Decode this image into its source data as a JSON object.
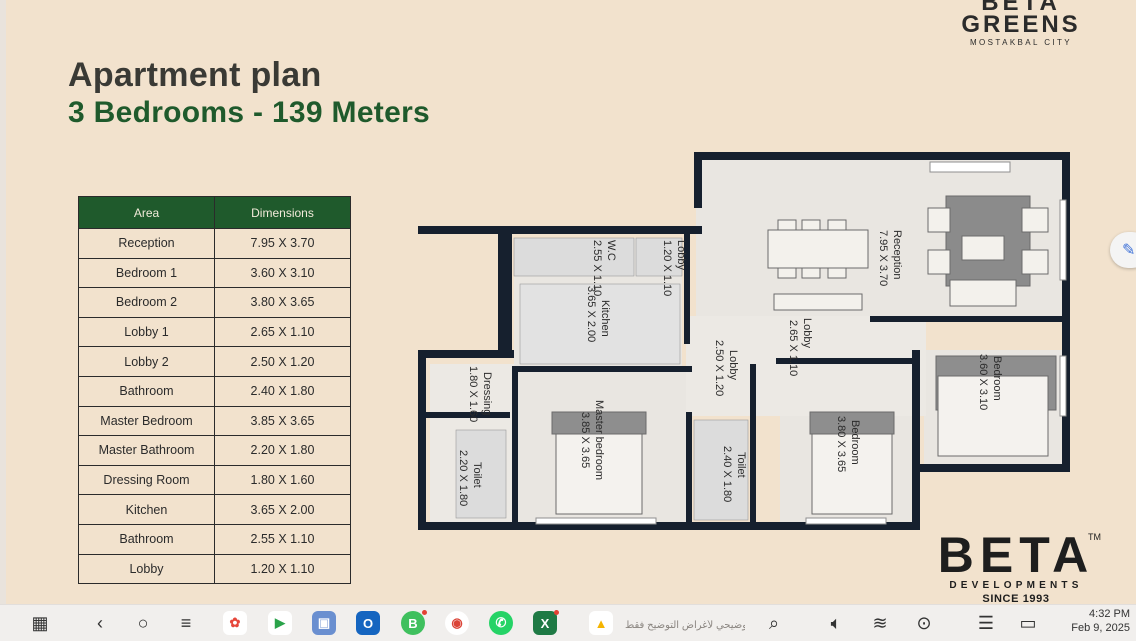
{
  "title": "Apartment plan",
  "subtitle": "3 Bedrooms - 139 Meters",
  "brand_top": {
    "line1": "BETA",
    "line2": "GREENS",
    "line3": "MOSTAKBAL CITY"
  },
  "brand_bottom": {
    "name": "BETA",
    "tm": "TM",
    "tagline": "DEVELOPMENTS",
    "since": "SINCE 1993"
  },
  "table": {
    "headers": [
      "Area",
      "Dimensions"
    ],
    "rows": [
      [
        "Reception",
        "7.95 X 3.70"
      ],
      [
        "Bedroom 1",
        "3.60 X 3.10"
      ],
      [
        "Bedroom 2",
        "3.80 X 3.65"
      ],
      [
        "Lobby 1",
        "2.65 X 1.10"
      ],
      [
        "Lobby 2",
        "2.50 X 1.20"
      ],
      [
        "Bathroom",
        "2.40 X 1.80"
      ],
      [
        "Master Bedroom",
        "3.85 X 3.65"
      ],
      [
        "Master Bathroom",
        "2.20 X 1.80"
      ],
      [
        "Dressing Room",
        "1.80 X 1.60"
      ],
      [
        "Kitchen",
        "3.65 X 2.00"
      ],
      [
        "Bathroom",
        "2.55 X 1.10"
      ],
      [
        "Lobby",
        "1.20 X 1.10"
      ]
    ]
  },
  "plan_labels": {
    "reception": [
      "Reception",
      "7.95 X 3.70"
    ],
    "wc": [
      "W.C",
      "2.55 X 1.10"
    ],
    "lobby_small": [
      "Lobby",
      "1.20 X 1.10"
    ],
    "kitchen": [
      "Kitchen",
      "3.65 X 2.00"
    ],
    "lobby1": [
      "Lobby",
      "2.65 X 1.10"
    ],
    "lobby2": [
      "Lobby",
      "2.50 X 1.20"
    ],
    "dressing": [
      "Dressing",
      "1.80 X 1.60"
    ],
    "toilet1": [
      "Toilet",
      "2.20 X 1.80"
    ],
    "master": [
      "Master bedroom",
      "3.85 X 3.65"
    ],
    "toilet2": [
      "Toilet",
      "2.40 X 1.80"
    ],
    "bedroom2": [
      "Bedroom",
      "3.80 X 3.65"
    ],
    "bedroom1": [
      "Bedroom",
      "3.60 X 3.10"
    ]
  },
  "taskbar": {
    "icons": [
      "apps-grid-icon",
      "back-icon",
      "home-icon",
      "menu-icon",
      "photos-icon",
      "play-store-icon",
      "gallery-icon",
      "outlook-icon",
      "whatsapp-business-icon",
      "chrome-icon",
      "whatsapp-icon",
      "excel-icon",
      "drive-icon",
      "search-icon",
      "volume-icon",
      "wifi-icon",
      "location-icon",
      "notes-icon",
      "battery-icon"
    ],
    "ticker": "عرض توضيحي لأغراض التوضيح فقط",
    "time": "4:32 PM",
    "date": "Feb 9, 2025"
  },
  "colors": {
    "accent_green": "#1f5a2c",
    "background": "#f2e2cd",
    "wall": "#16202e"
  }
}
